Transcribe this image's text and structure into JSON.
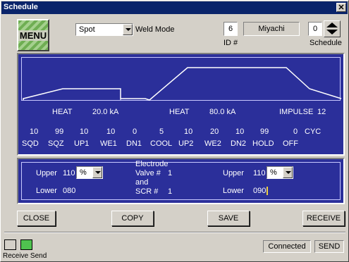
{
  "window": {
    "title": "Schedule",
    "close_glyph": "✕"
  },
  "header": {
    "menu_label": "MENU",
    "weld_mode_value": "Spot",
    "weld_mode_label": "Weld Mode",
    "id_value": "6",
    "id_label": "ID #",
    "brand": "Miyachi",
    "schedule_value": "0",
    "schedule_label": "Schedule"
  },
  "waveform": {
    "heat1_label": "HEAT",
    "heat1_value": "20.0 kA",
    "heat2_label": "HEAT",
    "heat2_value": "80.0 kA",
    "impulse_label": "IMPULSE",
    "impulse_value": "12",
    "values": [
      "10",
      "99",
      "10",
      "10",
      "0",
      "5",
      "10",
      "20",
      "10",
      "99",
      "0"
    ],
    "unit": "CYC",
    "segments": [
      "SQD",
      "SQZ",
      "UP1",
      "WE1",
      "DN1",
      "COOL",
      "UP2",
      "WE2",
      "DN2",
      "HOLD",
      "OFF"
    ]
  },
  "limits": {
    "left_upper_label": "Upper",
    "left_upper_value": "110",
    "left_upper_unit": "%",
    "left_lower_label": "Lower",
    "left_lower_value": "080",
    "center_line1": "Electrode",
    "center_line2": "Valve #",
    "center_valve": "1",
    "center_line3": "and",
    "center_line4": "SCR #",
    "center_scr": "1",
    "right_upper_label": "Upper",
    "right_upper_value": "110",
    "right_upper_unit": "%",
    "right_lower_label": "Lower",
    "right_lower_value": "090"
  },
  "buttons": {
    "close": "CLOSE",
    "copy": "COPY",
    "save": "SAVE",
    "receive": "RECEIVE"
  },
  "status": {
    "indicators_label": "Receive Send",
    "connected": "Connected",
    "send": "SEND",
    "receive_color": "#d4d0c8",
    "send_color": "#4fc24f"
  }
}
